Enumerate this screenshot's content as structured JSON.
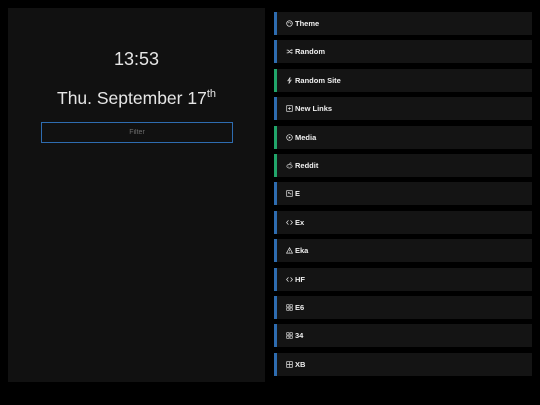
{
  "clock": {
    "time": "13:53"
  },
  "date": {
    "text": "Thu. September 17",
    "suffix": "th"
  },
  "filter": {
    "placeholder": "Filter",
    "value": ""
  },
  "colors": {
    "blue_accent": "#2e6cb0",
    "green_accent": "#21a56a"
  },
  "links": [
    {
      "label": "Theme",
      "icon": "palette-icon",
      "accent": "blue"
    },
    {
      "label": "Random",
      "icon": "shuffle-icon",
      "accent": "blue"
    },
    {
      "label": "Random Site",
      "icon": "bolt-icon",
      "accent": "green"
    },
    {
      "label": "New Links",
      "icon": "plus-square-icon",
      "accent": "blue"
    },
    {
      "label": "Media",
      "icon": "play-circle-icon",
      "accent": "green"
    },
    {
      "label": "Reddit",
      "icon": "reddit-icon",
      "accent": "green"
    },
    {
      "label": "E",
      "icon": "grid-square-icon",
      "accent": "blue"
    },
    {
      "label": "Ex",
      "icon": "code-icon",
      "accent": "blue"
    },
    {
      "label": "Eka",
      "icon": "warning-triangle-icon",
      "accent": "blue"
    },
    {
      "label": "HF",
      "icon": "code-icon",
      "accent": "blue"
    },
    {
      "label": "E6",
      "icon": "apps-icon",
      "accent": "blue"
    },
    {
      "label": "34",
      "icon": "apps-icon",
      "accent": "blue"
    },
    {
      "label": "XB",
      "icon": "grid-icon",
      "accent": "blue"
    }
  ]
}
